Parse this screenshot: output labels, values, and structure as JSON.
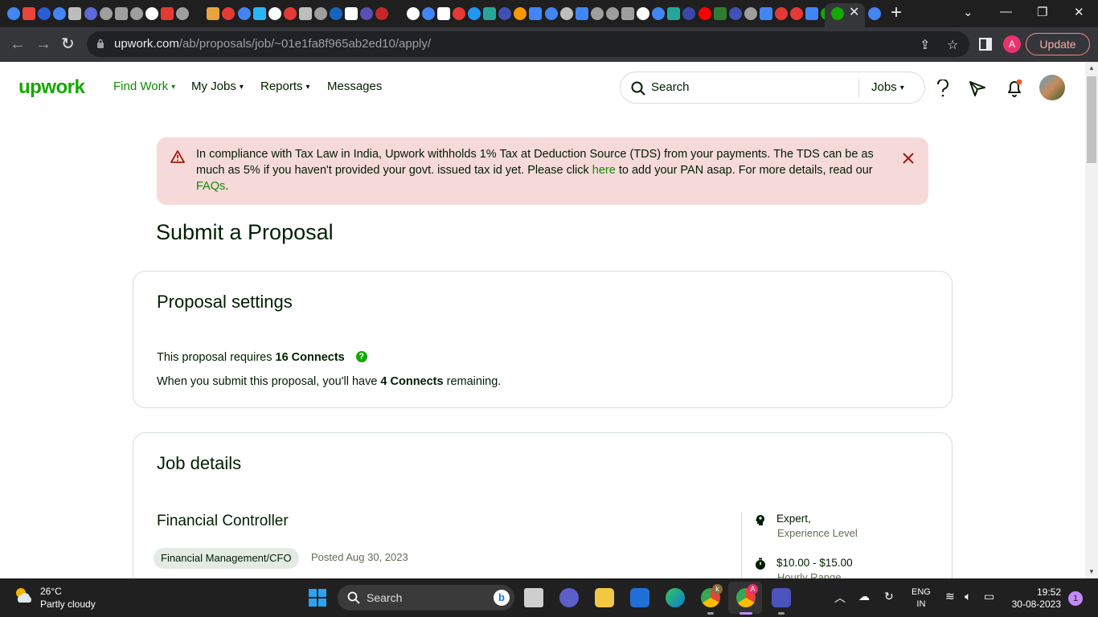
{
  "browser": {
    "url_host": "upwork.com",
    "url_path": "/ab/proposals/job/~01e1fa8f965ab2ed10/apply/",
    "profile_initial": "A",
    "update_label": "Update",
    "favicon_colors": [
      "#4285f4",
      "#e8453c",
      "#2c5bd6",
      "#4285f4",
      "#bdbdbd",
      "#5a6bd6",
      "#9e9e9e",
      "#9e9e9e",
      "#9e9e9e",
      "#ffffff",
      "#e53935",
      "#9e9e9e",
      "#1f1f1f",
      "#e8a33c",
      "#e53935",
      "#4285f4",
      "#29b6f6",
      "#ffffff",
      "#e53935",
      "#bdbdbd",
      "#9e9e9e",
      "#1565c0",
      "#ffffff",
      "#5a4fb5",
      "#c62828",
      "#1f1f1f",
      "#ffffff",
      "#4285f4",
      "#ffffff",
      "#e53935",
      "#2196f3",
      "#26a69a",
      "#3f51b5",
      "#ff9800",
      "#4285f4",
      "#4285f4",
      "#bdbdbd",
      "#4285f4",
      "#9e9e9e",
      "#9e9e9e",
      "#9e9e9e",
      "#ffffff",
      "#4285f4",
      "#26a69a",
      "#3949ab",
      "#ff0000",
      "#2e7d32",
      "#3f51b5",
      "#9e9e9e",
      "#4285f4",
      "#e53935",
      "#e53935",
      "#4285f4",
      "#14a800"
    ]
  },
  "header": {
    "logo": "upwork",
    "nav": [
      {
        "label": "Find Work",
        "has_chevron": true
      },
      {
        "label": "My Jobs",
        "has_chevron": true
      },
      {
        "label": "Reports",
        "has_chevron": true
      },
      {
        "label": "Messages",
        "has_chevron": false
      }
    ],
    "search_placeholder": "Search",
    "search_scope": "Jobs"
  },
  "alert": {
    "text_before": "In compliance with Tax Law in India, Upwork withholds 1% Tax at Deduction Source (TDS) from your payments. The TDS can be as much as 5% if you haven't provided your govt. issued tax id yet. Please click ",
    "link_here": "here",
    "text_middle": " to add your PAN asap. For more details, read our ",
    "link_faqs": "FAQs",
    "text_end": "."
  },
  "page_title": "Submit a Proposal",
  "proposal_settings": {
    "title": "Proposal settings",
    "requires_prefix": "This proposal requires ",
    "requires_value": "16 Connects",
    "remaining_prefix": "When you submit this proposal, you'll have ",
    "remaining_value": "4 Connects",
    "remaining_suffix": " remaining."
  },
  "job_details": {
    "title": "Job details",
    "job_title": "Financial Controller",
    "category": "Financial Management/CFO",
    "posted": "Posted Aug 30, 2023",
    "experience_value": "Expert,",
    "experience_label": "Experience Level",
    "rate_value": "$10.00 - $15.00",
    "rate_label": "Hourly Range"
  },
  "taskbar": {
    "temperature": "26°C",
    "condition": "Partly cloudy",
    "search_label": "Search",
    "language": "ENG",
    "region": "IN",
    "time": "19:52",
    "date": "30-08-2023",
    "notification_count": "1",
    "chrome_badge_k": "k",
    "chrome_badge_a": "A"
  }
}
